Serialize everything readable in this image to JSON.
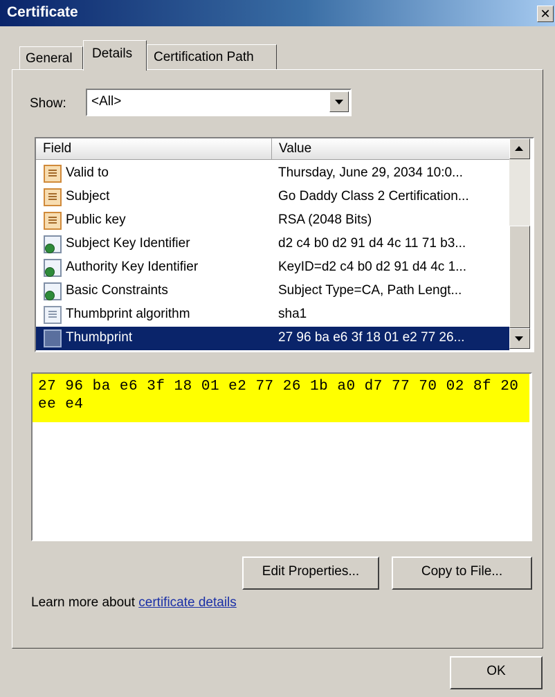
{
  "window": {
    "title": "Certificate",
    "close_label": "✕"
  },
  "tabs": [
    {
      "label": "General"
    },
    {
      "label": "Details"
    },
    {
      "label": "Certification Path"
    }
  ],
  "show": {
    "label": "Show:",
    "value": "<All>"
  },
  "table": {
    "columns": [
      "Field",
      "Value"
    ],
    "rows": [
      {
        "field": "Valid to",
        "value": "Thursday, June 29, 2034 10:0...",
        "icon": "document-icon"
      },
      {
        "field": "Subject",
        "value": "Go Daddy Class 2 Certification...",
        "icon": "document-icon"
      },
      {
        "field": "Public key",
        "value": "RSA (2048 Bits)",
        "icon": "document-icon"
      },
      {
        "field": "Subject Key Identifier",
        "value": "d2 c4 b0 d2 91 d4 4c 11 71 b3...",
        "icon": "extension-icon"
      },
      {
        "field": "Authority Key Identifier",
        "value": "KeyID=d2 c4 b0 d2 91 d4 4c 1...",
        "icon": "extension-icon"
      },
      {
        "field": "Basic Constraints",
        "value": "Subject Type=CA, Path Lengt...",
        "icon": "extension-icon"
      },
      {
        "field": "Thumbprint algorithm",
        "value": "sha1",
        "icon": "property-icon"
      },
      {
        "field": "Thumbprint",
        "value": "27 96 ba e6 3f 18 01 e2 77 26...",
        "icon": "property-icon",
        "selected": true
      }
    ]
  },
  "detail": {
    "text": "27 96 ba e6 3f 18 01 e2 77 26 1b a0 d7 77 70 02 8f 20 ee e4"
  },
  "buttons": {
    "edit_properties": "Edit Properties...",
    "copy_to_file": "Copy to File...",
    "ok": "OK"
  },
  "learn": {
    "prefix": "Learn more about ",
    "link": "certificate details"
  }
}
